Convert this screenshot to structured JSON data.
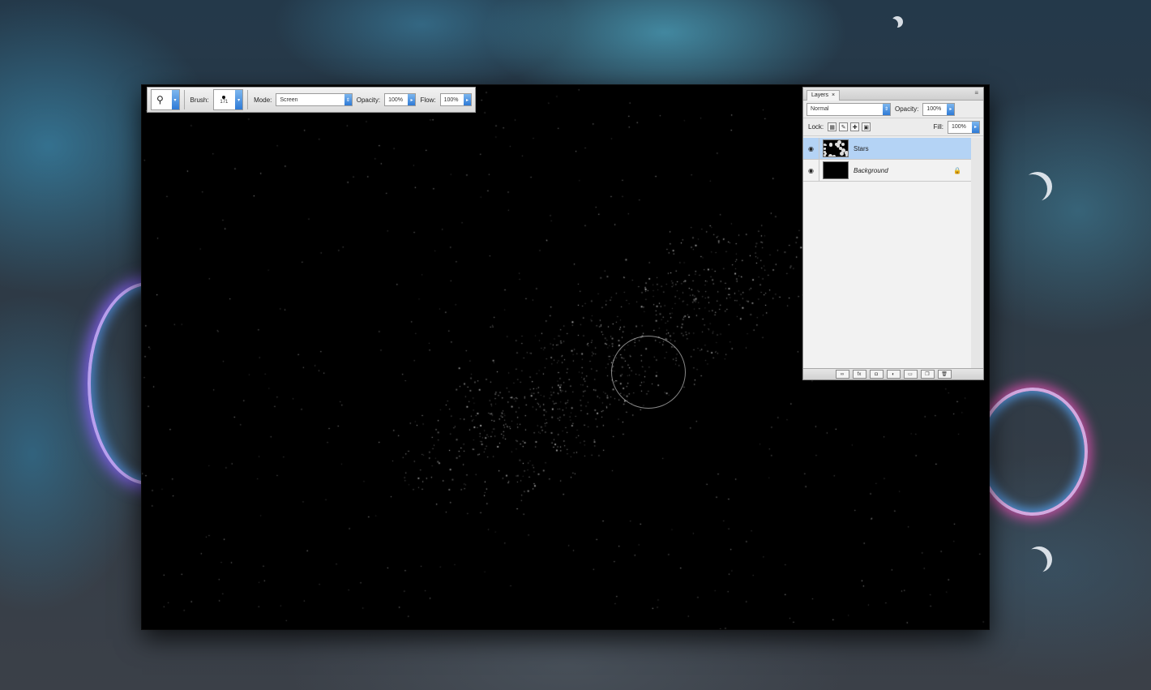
{
  "options_bar": {
    "brush_label": "Brush:",
    "brush_size": "171",
    "mode_label": "Mode:",
    "mode_value": "Screen",
    "opacity_label": "Opacity:",
    "opacity_value": "100%",
    "flow_label": "Flow:",
    "flow_value": "100%",
    "tool_icon": "stamp-icon"
  },
  "layers_panel": {
    "tab_label": "Layers",
    "tab_close": "×",
    "blend_mode": "Normal",
    "opacity_label": "Opacity:",
    "opacity_value": "100%",
    "lock_label": "Lock:",
    "fill_label": "Fill:",
    "fill_value": "100%",
    "layers": [
      {
        "name": "Stars",
        "selected": true
      },
      {
        "name": "Background",
        "selected": false,
        "locked": true
      }
    ],
    "footer_buttons": [
      "link-icon",
      "fx-icon",
      "mask-icon",
      "adjustment-icon",
      "folder-icon",
      "new-layer-icon",
      "trash-icon"
    ]
  },
  "colors": {
    "selection_blue": "#b4d3f5",
    "arrow_blue": "#2e7ad6",
    "canvas": "#000000"
  }
}
